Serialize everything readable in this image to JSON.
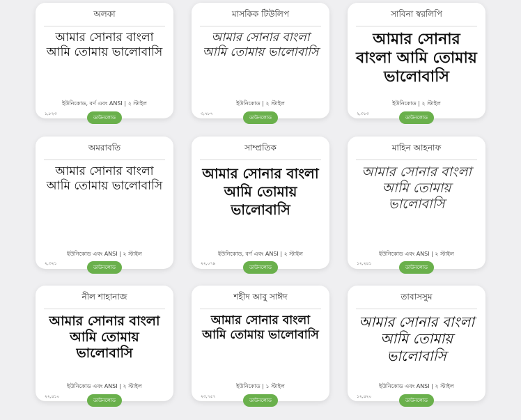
{
  "fonts": [
    {
      "name": "অলকা",
      "preview": "আমার সোনার বাংলা আমি তোমায় ভালোবাসি",
      "meta": "ইউনিকোড, বর্ণ এবং ANSI | ২ স্টাইল",
      "count": "১,৮২৩",
      "download": "ডাউনলোড"
    },
    {
      "name": "মাসকিক টিউলিপ",
      "preview": "আমার সোনার বাংলা আমি তোমায় ভালোবাসি",
      "meta": "ইউনিকোড | ২ স্টাইল",
      "count": "৩,৭৮৭",
      "download": "ডাউনলোড"
    },
    {
      "name": "সাবিনা স্বরলিপি",
      "preview": "আমার সোনার বাংলা আমি তোমায় ভালোবাসি",
      "meta": "ইউনিকোড | ২ স্টাইল",
      "count": "২,৩১৩",
      "download": "ডাউনলোড"
    },
    {
      "name": "অমরাবতি",
      "preview": "আমার সোনার বাংলা আমি তোমায় ভালোবাসি",
      "meta": "ইউনিকোড এবং ANSI | ২ স্টাইল",
      "count": "২,৩২১",
      "download": "ডাউনলোড"
    },
    {
      "name": "সাম্প্রতিক",
      "preview": "আমার সোনার বাংলা আমি তোমায় ভালোবাসি",
      "meta": "ইউনিকোড, বর্ণ এবং ANSI | ২ স্টাইল",
      "count": "২২,০৭৯",
      "download": "ডাউনলোড"
    },
    {
      "name": "মাহিন আহনাফ",
      "preview": "আমার সোনার বাংলা আমি তোমায় ভালোবাসি",
      "meta": "ইউনিকোড এবং ANSI | ২ স্টাইল",
      "count": "১২,২৪১",
      "download": "ডাউনলোড"
    },
    {
      "name": "নীল শাহানাজ",
      "preview": "আমার সোনার বাংলা আমি তোমায় ভালোবাসি",
      "meta": "ইউনিকোড এবং ANSI | ২ স্টাইল",
      "count": "২২,৪১০",
      "download": "ডাউনলোড"
    },
    {
      "name": "শহীদ আবু সাঈদ",
      "preview": "আমার সোনার বাংলা আমি তোমায় ভালোবাসি",
      "meta": "ইউনিকোড | ১ স্টাইল",
      "count": "২৩,৭৫৭",
      "download": "ডাউনলোড"
    },
    {
      "name": "তাবাসসুম",
      "preview": "আমার সোনার বাংলা আমি তোমায় ভালোবাসি",
      "meta": "ইউনিকোড এবং ANSI | ২ স্টাইল",
      "count": "১২,৪২০",
      "download": "ডাউনলোড"
    }
  ]
}
